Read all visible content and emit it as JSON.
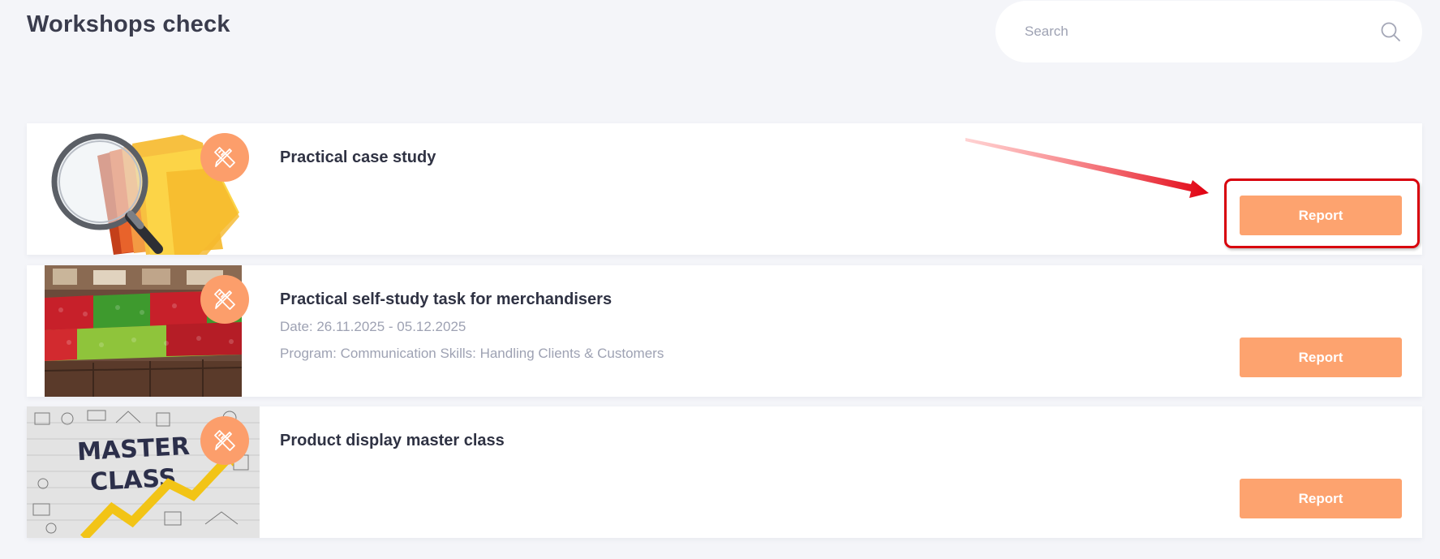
{
  "page": {
    "title": "Workshops check"
  },
  "search": {
    "placeholder": "Search",
    "value": "",
    "icon": "search-icon"
  },
  "theme": {
    "background": "#f4f5f9",
    "accent": "#fda36f",
    "badge": "#fc9e6b",
    "muted_text": "#9ea2b3",
    "annotation": "#d8000c"
  },
  "workshops": [
    {
      "title": "Practical case study",
      "date": "",
      "program": "",
      "report_label": "Report",
      "image": "folders-magnifying-glass",
      "badge_icon": "pencil-ruler-icon"
    },
    {
      "title": "Practical self-study task for merchandisers",
      "date": "Date: 26.11.2025 - 05.12.2025",
      "program": "Program: Communication Skills: Handling Clients & Customers",
      "report_label": "Report",
      "image": "apple-display",
      "badge_icon": "pencil-ruler-icon"
    },
    {
      "title": "Product display master class",
      "date": "",
      "program": "",
      "report_label": "Report",
      "image": "master-class-chalk",
      "badge_icon": "pencil-ruler-icon"
    }
  ],
  "annotation": {
    "highlighted_element": "Report",
    "arrow_color": "#d8000c"
  }
}
